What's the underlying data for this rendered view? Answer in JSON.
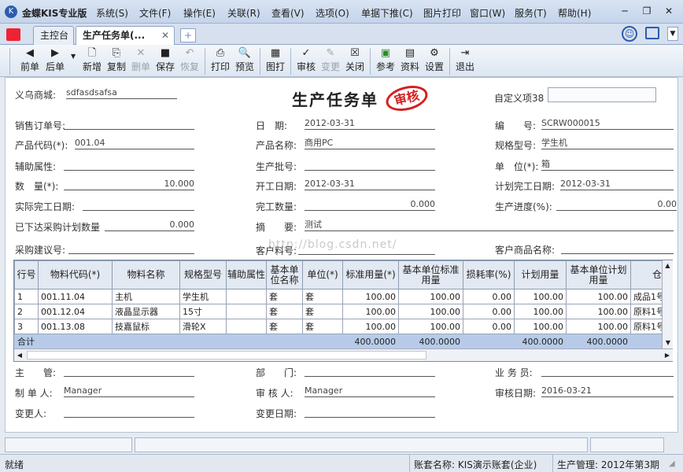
{
  "app": {
    "name": "金蝶KIS专业版"
  },
  "menu": [
    "系统(S)",
    "文件(F)",
    "操作(E)",
    "关联(R)",
    "查看(V)",
    "选项(O)",
    "单据下推(C)",
    "图片打印",
    "窗口(W)",
    "服务(T)",
    "帮助(H)"
  ],
  "tabs": [
    "主控台",
    "生产任务单(..."
  ],
  "toolbar": [
    "前单",
    "后单",
    "新增",
    "复制",
    "删单",
    "保存",
    "恢复",
    "打印",
    "预览",
    "图打",
    "审核",
    "变更",
    "关闭",
    "参考",
    "资料",
    "设置",
    "退出"
  ],
  "header": {
    "store_label": "义乌商城:",
    "store_value": "sdfasdsafsa",
    "title": "生产任务单",
    "stamp": "审核",
    "custom_label": "自定义项38"
  },
  "fields": {
    "so_label": "销售订单号:",
    "so_value": "",
    "date_label": "日　期:",
    "date_value": "2012-03-31",
    "no_label": "编　　号:",
    "no_value": "SCRW000015",
    "pcode_label": "产品代码(*):",
    "pcode_value": "001.04",
    "pname_label": "产品名称:",
    "pname_value": "商用PC",
    "spec_label": "规格型号:",
    "spec_value": "学生机",
    "aux_label": "辅助属性:",
    "aux_value": "",
    "batch_label": "生产批号:",
    "batch_value": "",
    "unit_label": "单　位(*):",
    "unit_value": "箱",
    "qty_label": "数　量(*):",
    "qty_value": "10.000",
    "start_label": "开工日期:",
    "start_value": "2012-03-31",
    "plan_end_label": "计划完工日期:",
    "plan_end_value": "2012-03-31",
    "act_end_label": "实际完工日期:",
    "act_end_value": "",
    "done_qty_label": "完工数量:",
    "done_qty_value": "0.000",
    "progress_label": "生产进度(%):",
    "progress_value": "0.00",
    "issued_label": "已下达采购计划数量",
    "issued_value": "0.000",
    "summary_label": "摘　　要:",
    "summary_value": "测试",
    "watermark": "http://blog.csdn.net/",
    "pr_label": "采购建议号:",
    "pr_value": "",
    "cust_item_label": "客户料号:",
    "cust_item_value": "",
    "cust_name_label": "客户商品名称:",
    "cust_name_value": ""
  },
  "table": {
    "columns": [
      "行号",
      "物料代码(*)",
      "物料名称",
      "规格型号",
      "辅助属性",
      "基本单位名称",
      "单位(*)",
      "标准用量(*)",
      "基本单位标准用量",
      "损耗率(%)",
      "计划用量",
      "基本单位计划用量",
      "仓"
    ],
    "rows": [
      [
        "1",
        "001.11.04",
        "主机",
        "学生机",
        "",
        "套",
        "套",
        "100.00",
        "100.00",
        "0.00",
        "100.00",
        "100.00",
        "成品1号"
      ],
      [
        "2",
        "001.12.04",
        "液晶显示器",
        "15寸",
        "",
        "套",
        "套",
        "100.00",
        "100.00",
        "0.00",
        "100.00",
        "100.00",
        "原料1号"
      ],
      [
        "3",
        "001.13.08",
        "技嘉鼠标",
        "滑轮X",
        "",
        "套",
        "套",
        "100.00",
        "100.00",
        "0.00",
        "100.00",
        "100.00",
        "原料1号"
      ]
    ],
    "total": [
      "合计",
      "",
      "",
      "",
      "",
      "",
      "",
      "400.0000",
      "400.0000",
      "",
      "400.0000",
      "400.0000",
      ""
    ]
  },
  "footer": {
    "mgr_label": "主　　管:",
    "mgr_value": "",
    "dept_label": "部　　门:",
    "dept_value": "",
    "sales_label": "业 务 员:",
    "sales_value": "",
    "maker_label": "制 单 人:",
    "maker_value": "Manager",
    "auditor_label": "审 核 人:",
    "auditor_value": "Manager",
    "audit_date_label": "审核日期:",
    "audit_date_value": "2016-03-21",
    "changer_label": "变更人:",
    "changer_value": "",
    "change_date_label": "变更日期:",
    "change_date_value": ""
  },
  "status": {
    "ready": "就绪",
    "account": "账套名称: KIS演示账套(企业)",
    "period": "生产管理: 2012年第3期"
  },
  "colors": {
    "accent": "#2a5cb0",
    "stamp": "#d42020",
    "total_row": "#b7cbe8"
  }
}
